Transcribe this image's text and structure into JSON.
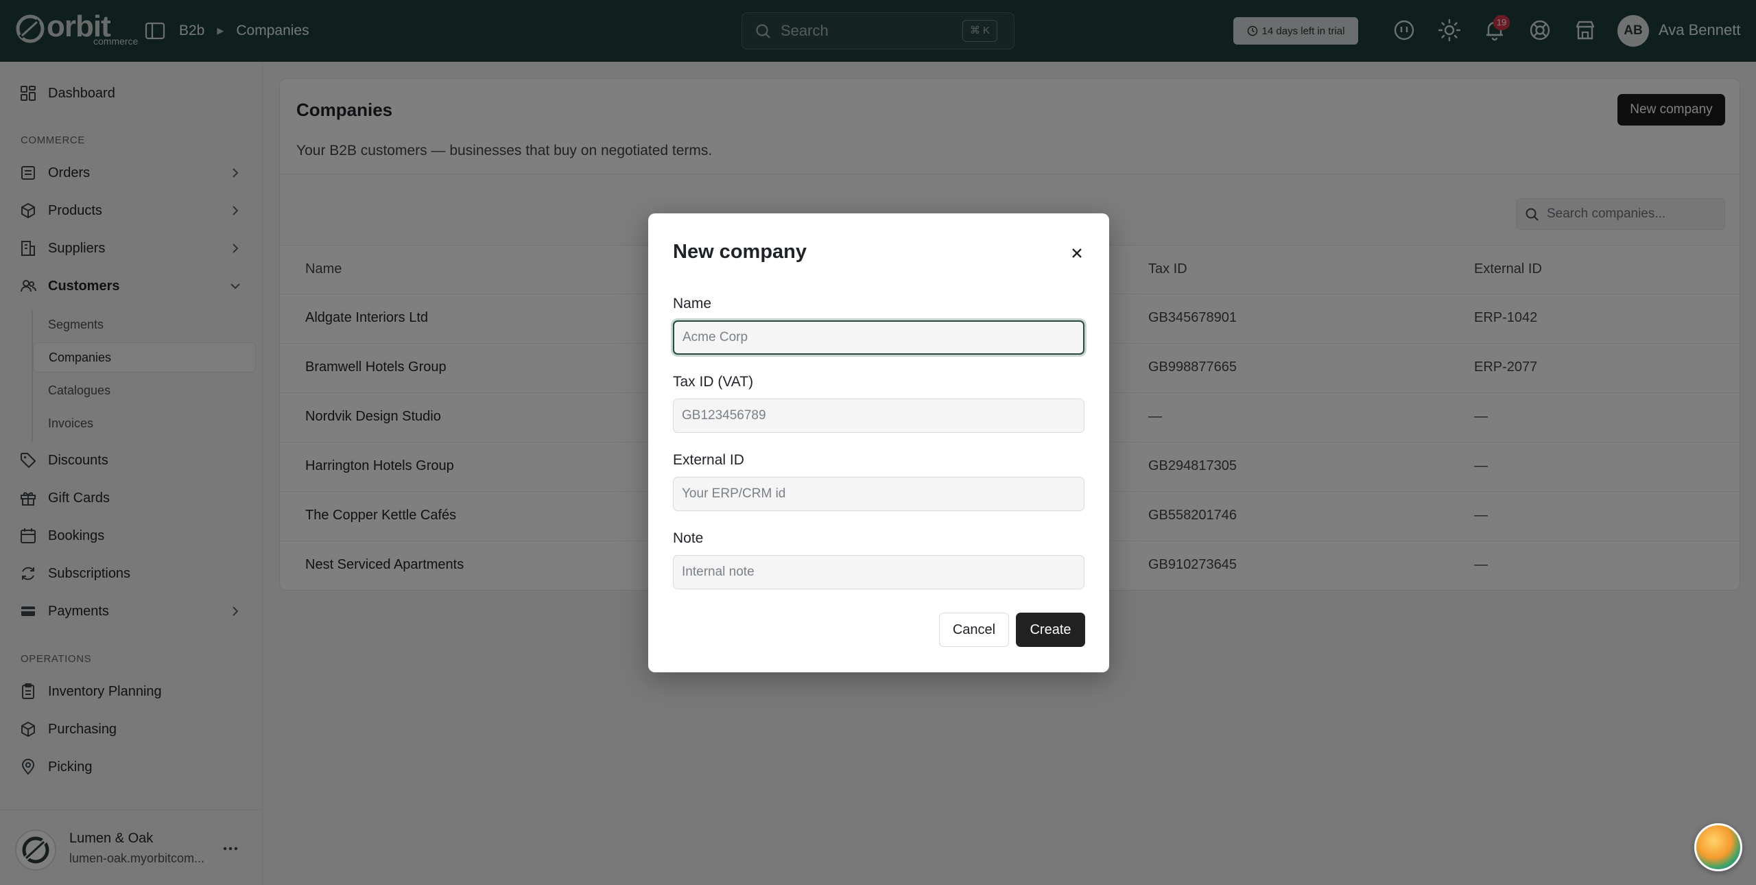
{
  "header": {
    "logo_text": "orbit",
    "logo_sub": "commerce",
    "breadcrumbs": [
      "B2b",
      "Companies"
    ],
    "search_placeholder": "Search",
    "search_shortcut": "⌘ K",
    "trial_text": "14 days left in trial",
    "notification_count": "19",
    "user_initials": "AB",
    "user_name": "Ava Bennett"
  },
  "sidebar": {
    "dashboard": "Dashboard",
    "section_commerce": "COMMERCE",
    "orders": "Orders",
    "products": "Products",
    "suppliers": "Suppliers",
    "customers": "Customers",
    "customers_sub": [
      "Segments",
      "Companies",
      "Catalogues",
      "Invoices"
    ],
    "discounts": "Discounts",
    "gift_cards": "Gift Cards",
    "bookings": "Bookings",
    "subscriptions": "Subscriptions",
    "payments": "Payments",
    "section_operations": "OPERATIONS",
    "inventory_planning": "Inventory Planning",
    "purchasing": "Purchasing",
    "picking": "Picking",
    "org_name": "Lumen & Oak",
    "org_url": "lumen-oak.myorbitcom..."
  },
  "page": {
    "title": "Companies",
    "new_button": "New company",
    "description": "Your B2B customers — businesses that buy on negotiated terms.",
    "table_search_placeholder": "Search companies...",
    "columns": {
      "name": "Name",
      "tax_id": "Tax ID",
      "external_id": "External ID"
    },
    "rows": [
      {
        "name": "Aldgate Interiors Ltd",
        "tax_id": "GB345678901",
        "external_id": "ERP-1042"
      },
      {
        "name": "Bramwell Hotels Group",
        "tax_id": "GB998877665",
        "external_id": "ERP-2077"
      },
      {
        "name": "Nordvik Design Studio",
        "tax_id": "—",
        "external_id": "—"
      },
      {
        "name": "Harrington Hotels Group",
        "tax_id": "GB294817305",
        "external_id": "—"
      },
      {
        "name": "The Copper Kettle Cafés",
        "tax_id": "GB558201746",
        "external_id": "—"
      },
      {
        "name": "Nest Serviced Apartments",
        "tax_id": "GB910273645",
        "external_id": "—"
      }
    ]
  },
  "modal": {
    "title": "New company",
    "name_label": "Name",
    "name_placeholder": "Acme Corp",
    "tax_label": "Tax ID (VAT)",
    "tax_placeholder": "GB123456789",
    "external_label": "External ID",
    "external_placeholder": "Your ERP/CRM id",
    "note_label": "Note",
    "note_placeholder": "Internal note",
    "cancel": "Cancel",
    "create": "Create"
  }
}
